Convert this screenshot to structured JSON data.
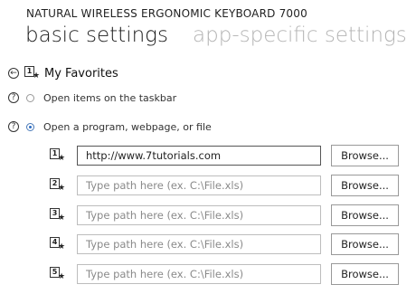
{
  "app_title": "NATURAL WIRELESS ERGONOMIC KEYBOARD 7000",
  "tabs": [
    {
      "label": "basic settings",
      "active": true
    },
    {
      "label": "app-specific settings",
      "active": false
    }
  ],
  "section": {
    "key_number": "1",
    "title": "My Favorites"
  },
  "options": [
    {
      "help": "?",
      "label": "Open items on the taskbar",
      "selected": false
    },
    {
      "help": "?",
      "label": "Open a program, webpage, or file",
      "selected": true
    }
  ],
  "favorites": [
    {
      "key": "1",
      "value": "http://www.7tutorials.com",
      "placeholder": "Type path here (ex. C:\\File.xls)",
      "browse": "Browse..."
    },
    {
      "key": "2",
      "value": "",
      "placeholder": "Type path here (ex. C:\\File.xls)",
      "browse": "Browse..."
    },
    {
      "key": "3",
      "value": "",
      "placeholder": "Type path here (ex. C:\\File.xls)",
      "browse": "Browse..."
    },
    {
      "key": "4",
      "value": "",
      "placeholder": "Type path here (ex. C:\\File.xls)",
      "browse": "Browse..."
    },
    {
      "key": "5",
      "value": "",
      "placeholder": "Type path here (ex. C:\\File.xls)",
      "browse": "Browse..."
    }
  ],
  "icons": {
    "back": "back-arrow-icon",
    "help": "help-icon",
    "favorite_key": "favorite-key-star-icon",
    "star": "★",
    "arrow": "←"
  }
}
